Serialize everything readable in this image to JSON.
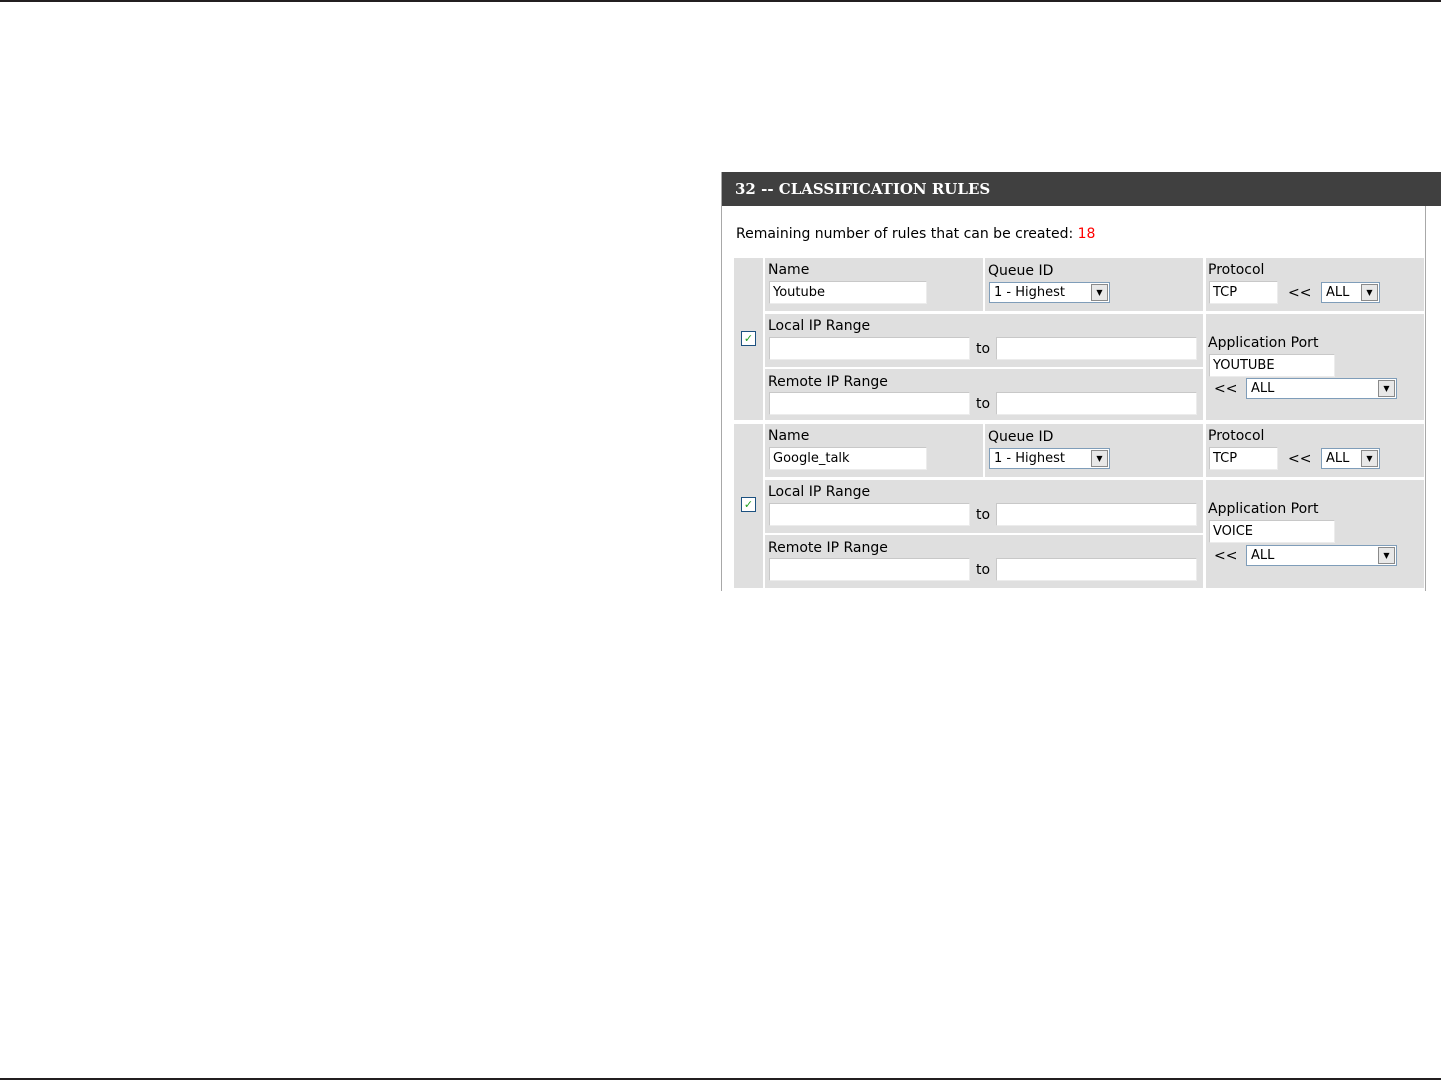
{
  "panel": {
    "title": "32 -- CLASSIFICATION RULES",
    "remaining_label": "Remaining number of rules that can be created:",
    "remaining_count": "18"
  },
  "labels": {
    "name": "Name",
    "queue_id": "Queue ID",
    "protocol": "Protocol",
    "local_ip_range": "Local IP Range",
    "remote_ip_range": "Remote IP Range",
    "application_port": "Application Port",
    "to": "to",
    "arrow": "<<"
  },
  "rules": [
    {
      "checked": true,
      "name": "Youtube",
      "queue_id": "1 - Highest",
      "protocol": "TCP",
      "protocol_select": "ALL",
      "local_ip_from": "",
      "local_ip_to": "",
      "remote_ip_from": "",
      "remote_ip_to": "",
      "application_port": "YOUTUBE",
      "application_select": "ALL"
    },
    {
      "checked": true,
      "name": "Google_talk",
      "queue_id": "1 - Highest",
      "protocol": "TCP",
      "protocol_select": "ALL",
      "local_ip_from": "",
      "local_ip_to": "",
      "remote_ip_from": "",
      "remote_ip_to": "",
      "application_port": "VOICE",
      "application_select": "ALL"
    }
  ],
  "colors": {
    "header_bg": "#404040",
    "cell_bg": "#dfdfdf",
    "remaining_count": "#ff0000",
    "checkmark": "#21a121"
  },
  "icons": [
    "checkmark-icon",
    "dropdown-arrow-icon"
  ]
}
